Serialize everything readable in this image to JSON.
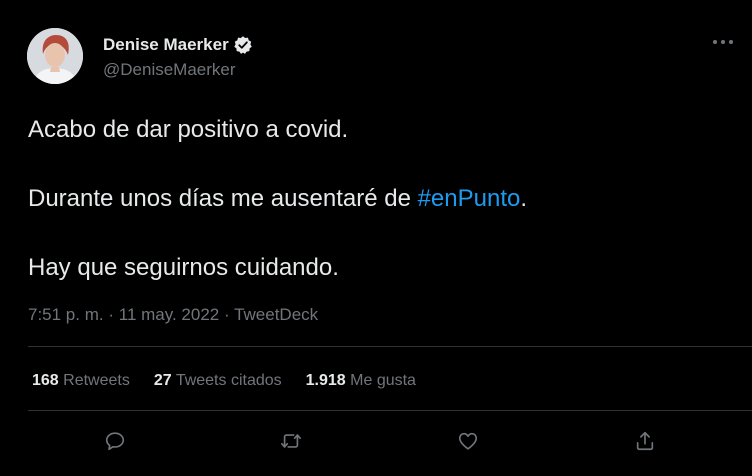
{
  "author": {
    "display_name": "Denise Maerker",
    "handle": "@DeniseMaerker",
    "verified": true,
    "avatar_icon": "profile-photo"
  },
  "tweet": {
    "line1": "Acabo de dar positivo a covid.",
    "line2_before": "Durante unos días me ausentaré de ",
    "line2_hashtag": "#enPunto",
    "line2_after": ".",
    "line3": "Hay que seguirnos cuidando."
  },
  "meta": {
    "time": "7:51 p. m.",
    "separator": "·",
    "date": "11 may. 2022",
    "source": "TweetDeck"
  },
  "stats": {
    "retweets_count": "168",
    "retweets_label": "Retweets",
    "quotes_count": "27",
    "quotes_label": "Tweets citados",
    "likes_count": "1.918",
    "likes_label": "Me gusta"
  },
  "actions": [
    "reply-icon",
    "retweet-icon",
    "like-icon",
    "share-icon"
  ],
  "colors": {
    "background": "#000000",
    "text": "#e7e9ea",
    "secondary": "#71767b",
    "accent": "#1d9bf0",
    "divider": "#2f3336"
  }
}
